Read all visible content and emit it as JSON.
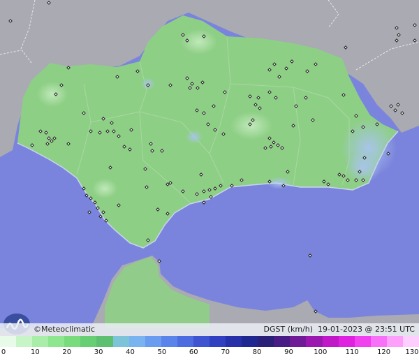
{
  "brand": {
    "symbol": "©",
    "name": "Meteoclimatic"
  },
  "header": {
    "variable": "DGST",
    "unit": "(km/h)",
    "date": "19-01-2023",
    "at": "@",
    "time": "23:51 UTC"
  },
  "legend": {
    "ticks": [
      "0",
      "10",
      "20",
      "30",
      "40",
      "50",
      "60",
      "70",
      "80",
      "90",
      "100",
      "110",
      "120",
      "130"
    ],
    "colors": [
      "#e8fbe8",
      "#c8f5c8",
      "#a8eea8",
      "#8ee68e",
      "#78dc7c",
      "#66cf74",
      "#5cc070",
      "#7ec4d8",
      "#7ab4f0",
      "#6a9cf0",
      "#5a84ea",
      "#4c6ce0",
      "#3e54d0",
      "#3040c0",
      "#2630a8",
      "#1e2890",
      "#2a2078",
      "#481c84",
      "#701a98",
      "#9a18b0",
      "#c018c8",
      "#e020e0",
      "#f040f0",
      "#f870f8",
      "#fca0fc",
      "#fecefe"
    ]
  },
  "colors": {
    "sea": "#7b84dc",
    "land_outside": "#a9aab2",
    "land_region": "#8ecf86",
    "wind_high": "#9ab8e4"
  }
}
